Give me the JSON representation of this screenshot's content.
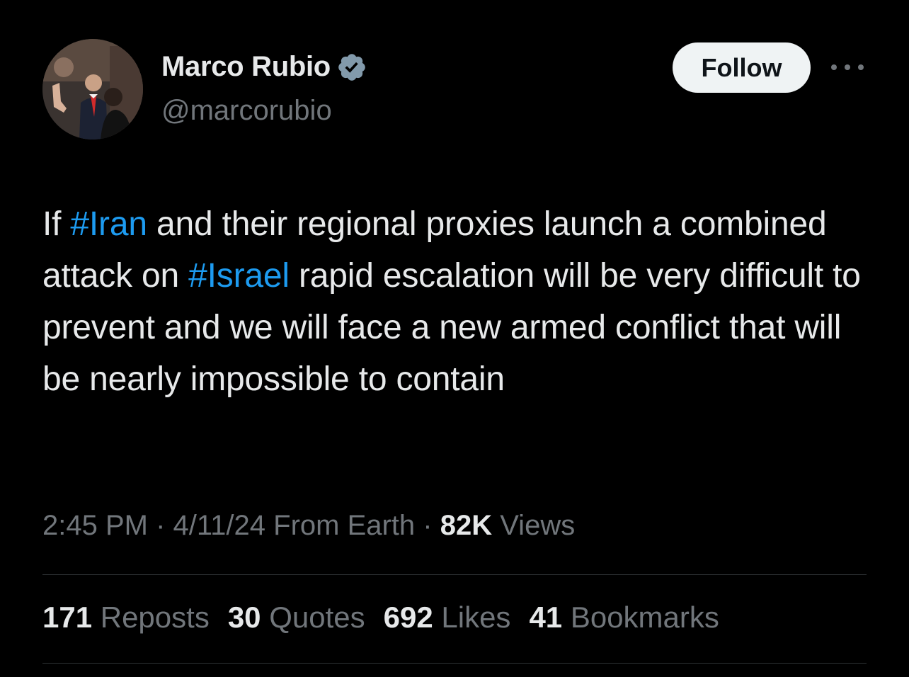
{
  "author": {
    "display_name": "Marco Rubio",
    "handle": "@marcorubio",
    "verified": true,
    "verified_color": "#829aab"
  },
  "actions": {
    "follow_label": "Follow",
    "more_icon": "more-horizontal-icon"
  },
  "tweet": {
    "segments": [
      {
        "text": "If ",
        "type": "text"
      },
      {
        "text": "#Iran",
        "type": "hashtag"
      },
      {
        "text": " and their regional proxies launch a combined attack on ",
        "type": "text"
      },
      {
        "text": "#Israel",
        "type": "hashtag"
      },
      {
        "text": " rapid escalation will be very difficult to prevent and we will face a new armed conflict that will be nearly impossible to contain",
        "type": "text"
      }
    ],
    "hashtag_color": "#1d9bf0"
  },
  "meta": {
    "time": "2:45 PM",
    "sep1": " · ",
    "date": "4/11/24",
    "source": " From Earth",
    "sep2": " · ",
    "views_count": "82K",
    "views_label": " Views"
  },
  "stats": [
    {
      "count": "171",
      "label": " Reposts"
    },
    {
      "count": "30",
      "label": " Quotes"
    },
    {
      "count": "692",
      "label": " Likes"
    },
    {
      "count": "41",
      "label": " Bookmarks"
    }
  ],
  "colors": {
    "background": "#000000",
    "text_primary": "#e7e9ea",
    "text_secondary": "#71767b",
    "divider": "#2f3336",
    "follow_bg": "#eff3f4"
  }
}
